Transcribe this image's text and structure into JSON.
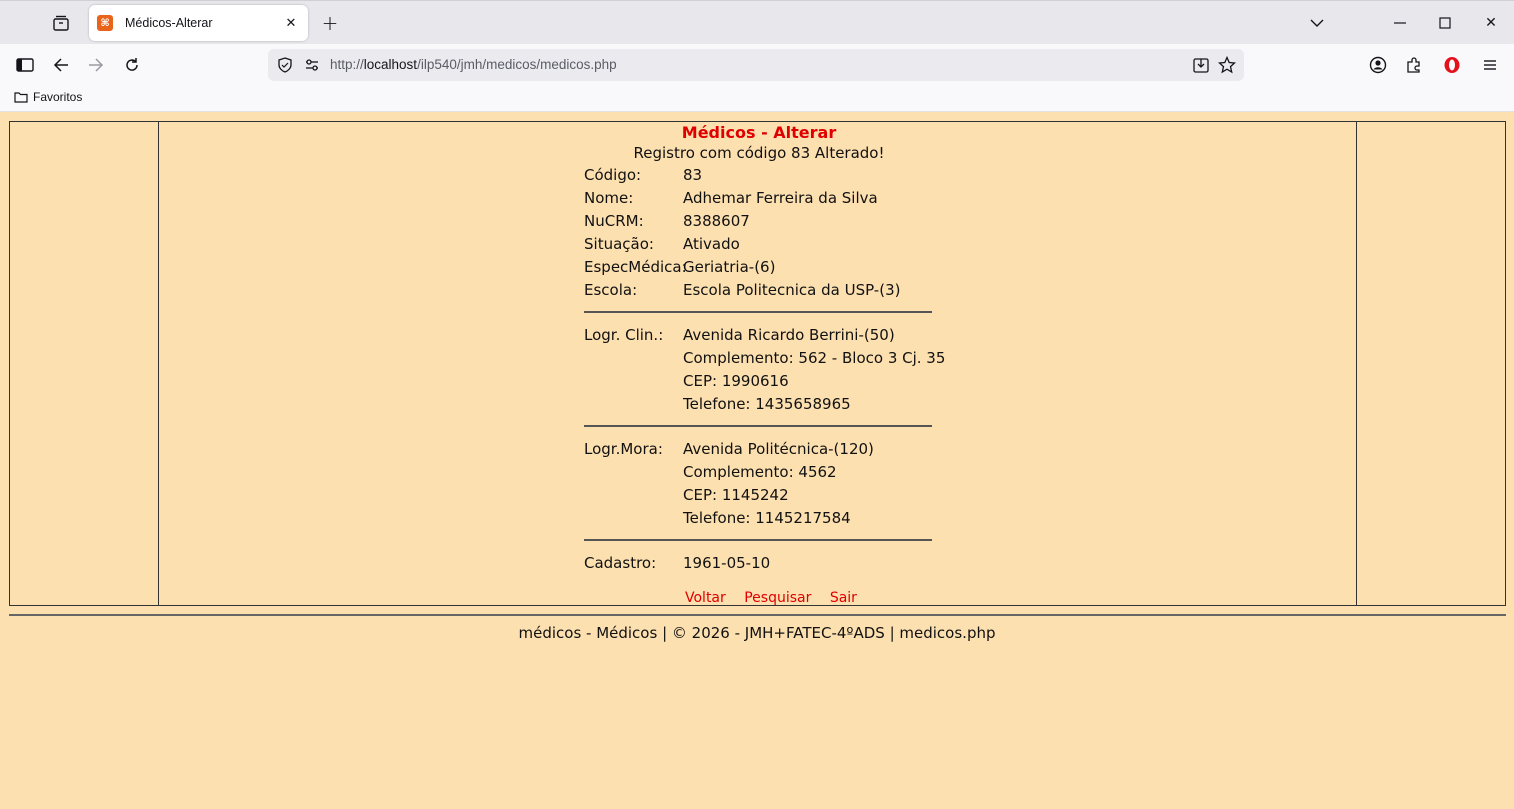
{
  "browser": {
    "tab_title": "Médicos-Alterar",
    "url_prefix": "http://",
    "url_host": "localhost",
    "url_path": "/ilp540/jmh/medicos/medicos.php",
    "bookmarks": [
      "Favoritos"
    ],
    "favicon_color": "#e8641b"
  },
  "page": {
    "title": "Médicos - Alterar",
    "subtitle": "Registro com código 83 Alterado!",
    "fields": [
      {
        "label": "Código:",
        "value": "83"
      },
      {
        "label": "Nome:",
        "value": "Adhemar Ferreira da Silva"
      },
      {
        "label": "NuCRM:",
        "value": "8388607"
      },
      {
        "label": "Situação:",
        "value": "Ativado"
      },
      {
        "label": "EspecMédica:",
        "value": "Geriatria-(6)"
      },
      {
        "label": "Escola:",
        "value": "Escola Politecnica da USP-(3)"
      }
    ],
    "clinic": {
      "label": "Logr. Clin.:",
      "lines": [
        "Avenida Ricardo Berrini-(50)",
        "Complemento: 562 - Bloco 3 Cj. 35",
        "CEP: 1990616",
        "Telefone: 1435658965"
      ]
    },
    "home": {
      "label": "Logr.Mora:",
      "lines": [
        "Avenida Politécnica-(120)",
        "Complemento: 4562",
        "CEP: 1145242",
        "Telefone: 1145217584"
      ]
    },
    "cadastro": {
      "label": "Cadastro:",
      "value": "1961-05-10"
    },
    "actions": [
      "Voltar",
      "Pesquisar",
      "Sair"
    ],
    "footer": "médicos - Médicos | © 2026 - JMH+FATEC-4ºADS | medicos.php",
    "colors": {
      "background": "#fde0b0",
      "accent": "#e00000"
    }
  }
}
